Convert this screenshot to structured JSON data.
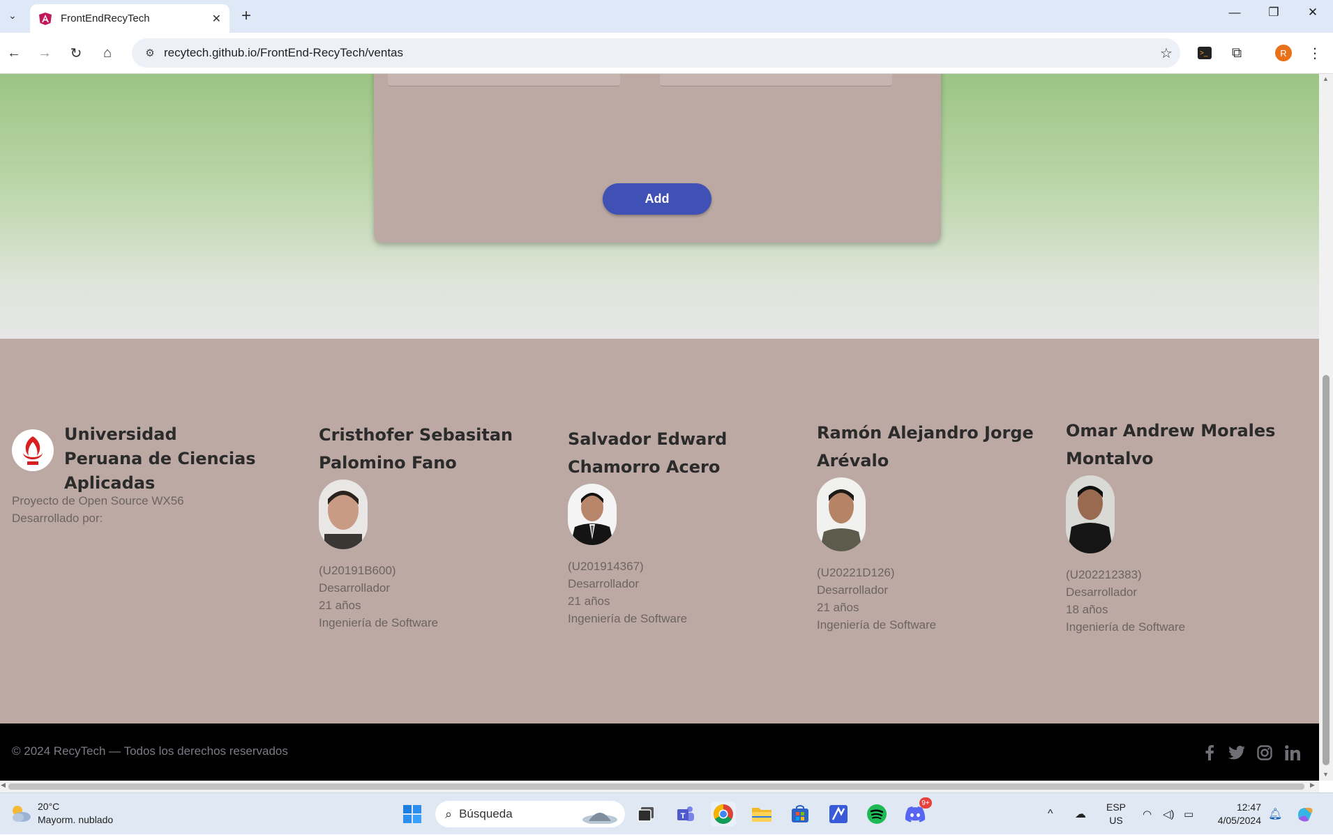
{
  "browser": {
    "tab_title": "FrontEndRecyTech",
    "url": "recytech.github.io/FrontEnd-RecyTech/ventas",
    "profile_initial": "R"
  },
  "form": {
    "add_label": "Add"
  },
  "footer": {
    "university": "Universidad Peruana de Ciencias Aplicadas",
    "project": "Proyecto de Open Source WX56",
    "developed_by": "Desarrollado por:",
    "members": [
      {
        "name": "Cristhofer Sebasitan Palomino Fano",
        "code": "(U20191B600)",
        "role": "Desarrollador",
        "age": "21 años",
        "career": "Ingeniería de Software"
      },
      {
        "name": "Salvador Edward Chamorro Acero",
        "code": "(U201914367)",
        "role": "Desarrollador",
        "age": "21 años",
        "career": "Ingeniería de Software"
      },
      {
        "name": "Ramón Alejandro Jorge Arévalo",
        "code": "(U20221D126)",
        "role": "Desarrollador",
        "age": "21 años",
        "career": "Ingeniería de Software"
      },
      {
        "name": "Omar Andrew Morales Montalvo",
        "code": "(U202212383)",
        "role": "Desarrollador",
        "age": "18 años",
        "career": "Ingeniería de Software"
      }
    ],
    "copyright": "© 2024 RecyTech — Todos los derechos reservados"
  },
  "taskbar": {
    "temperature": "20°C",
    "weather": "Mayorm. nublado",
    "search_placeholder": "Búsqueda",
    "lang": "ESP",
    "region": "US",
    "time": "12:47",
    "date": "4/05/2024",
    "discord_badge": "9+"
  }
}
